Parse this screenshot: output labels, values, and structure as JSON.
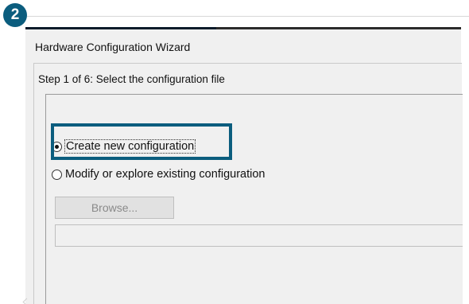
{
  "badge": {
    "number": "2",
    "color": "#0b5d7e"
  },
  "dialog": {
    "title": "Hardware Configuration Wizard",
    "step_label": "Step 1 of 6: Select the configuration file",
    "options": [
      {
        "label": "Create new configuration",
        "selected": true
      },
      {
        "label": "Modify or explore existing configuration",
        "selected": false
      }
    ],
    "browse_label": "Browse...",
    "browse_enabled": false,
    "file_path_value": ""
  },
  "highlight": {
    "target": "Create new configuration",
    "color": "#0b5d7e"
  },
  "icons": {
    "radio_selected": "radio-selected-icon",
    "radio_unselected": "radio-unselected-icon"
  }
}
